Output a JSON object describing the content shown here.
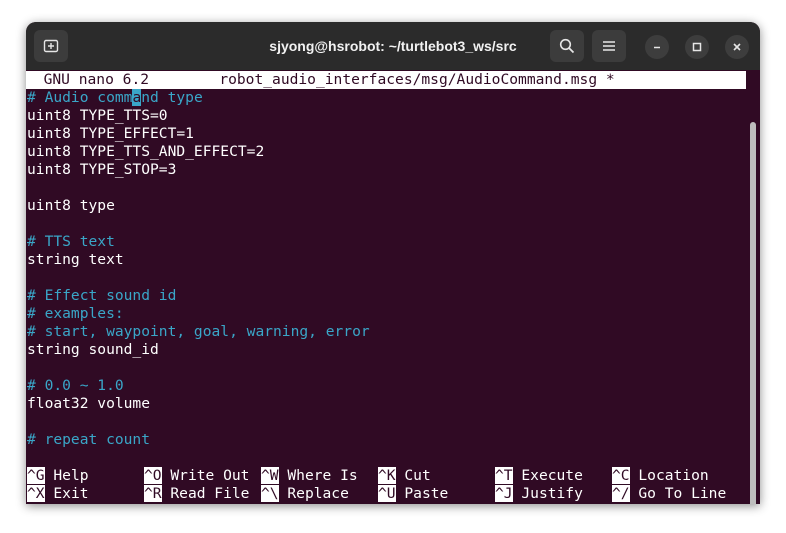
{
  "window": {
    "title": "sjyong@hsrobot: ~/turtlebot3_ws/src"
  },
  "nano": {
    "version_label": "GNU nano 6.2",
    "filename": "robot_audio_interfaces/msg/AudioCommand.msg",
    "modified_marker": "*",
    "cursor_line": {
      "before": "# Audio comm",
      "cursor": "a",
      "after": "nd type"
    },
    "lines": [
      {
        "text": "uint8 TYPE_TTS=0",
        "comment": false
      },
      {
        "text": "uint8 TYPE_EFFECT=1",
        "comment": false
      },
      {
        "text": "uint8 TYPE_TTS_AND_EFFECT=2",
        "comment": false
      },
      {
        "text": "uint8 TYPE_STOP=3",
        "comment": false
      },
      {
        "text": "",
        "comment": false
      },
      {
        "text": "uint8 type",
        "comment": false
      },
      {
        "text": "",
        "comment": false
      },
      {
        "text": "# TTS text",
        "comment": true
      },
      {
        "text": "string text",
        "comment": false
      },
      {
        "text": "",
        "comment": false
      },
      {
        "text": "# Effect sound id",
        "comment": true
      },
      {
        "text": "# examples:",
        "comment": true
      },
      {
        "text": "# start, waypoint, goal, warning, error",
        "comment": true
      },
      {
        "text": "string sound_id",
        "comment": false
      },
      {
        "text": "",
        "comment": false
      },
      {
        "text": "# 0.0 ~ 1.0",
        "comment": true
      },
      {
        "text": "float32 volume",
        "comment": false
      },
      {
        "text": "",
        "comment": false
      },
      {
        "text": "# repeat count",
        "comment": true
      }
    ],
    "shortcuts": [
      [
        {
          "key": "^G",
          "label": "Help"
        },
        {
          "key": "^O",
          "label": "Write Out"
        },
        {
          "key": "^W",
          "label": "Where Is"
        },
        {
          "key": "^K",
          "label": "Cut"
        },
        {
          "key": "^T",
          "label": "Execute"
        },
        {
          "key": "^C",
          "label": "Location"
        }
      ],
      [
        {
          "key": "^X",
          "label": "Exit"
        },
        {
          "key": "^R",
          "label": "Read File"
        },
        {
          "key": "^\\",
          "label": "Replace"
        },
        {
          "key": "^U",
          "label": "Paste"
        },
        {
          "key": "^J",
          "label": "Justify"
        },
        {
          "key": "^/",
          "label": "Go To Line"
        }
      ]
    ]
  }
}
